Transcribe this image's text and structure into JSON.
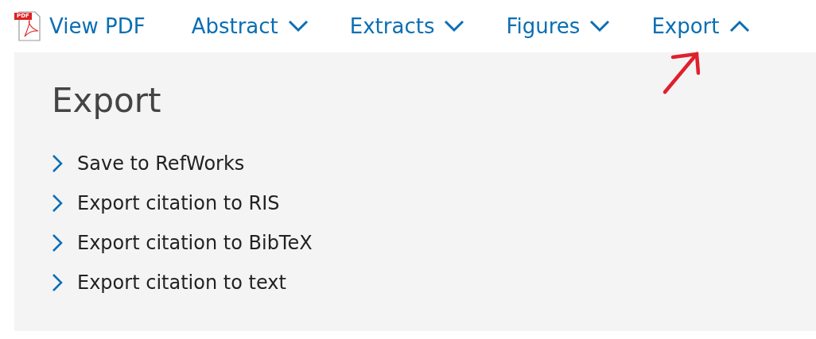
{
  "nav": [
    {
      "kind": "pdf",
      "label": "View PDF",
      "icon_label": "PDF"
    },
    {
      "kind": "dropdown",
      "label": "Abstract",
      "expanded": false
    },
    {
      "kind": "dropdown",
      "label": "Extracts",
      "expanded": false
    },
    {
      "kind": "dropdown",
      "label": "Figures",
      "expanded": false
    },
    {
      "kind": "dropdown",
      "label": "Export",
      "expanded": true
    }
  ],
  "panel": {
    "title": "Export",
    "items": [
      "Save to RefWorks",
      "Export citation to RIS",
      "Export citation to BibTeX",
      "Export citation to text"
    ]
  }
}
